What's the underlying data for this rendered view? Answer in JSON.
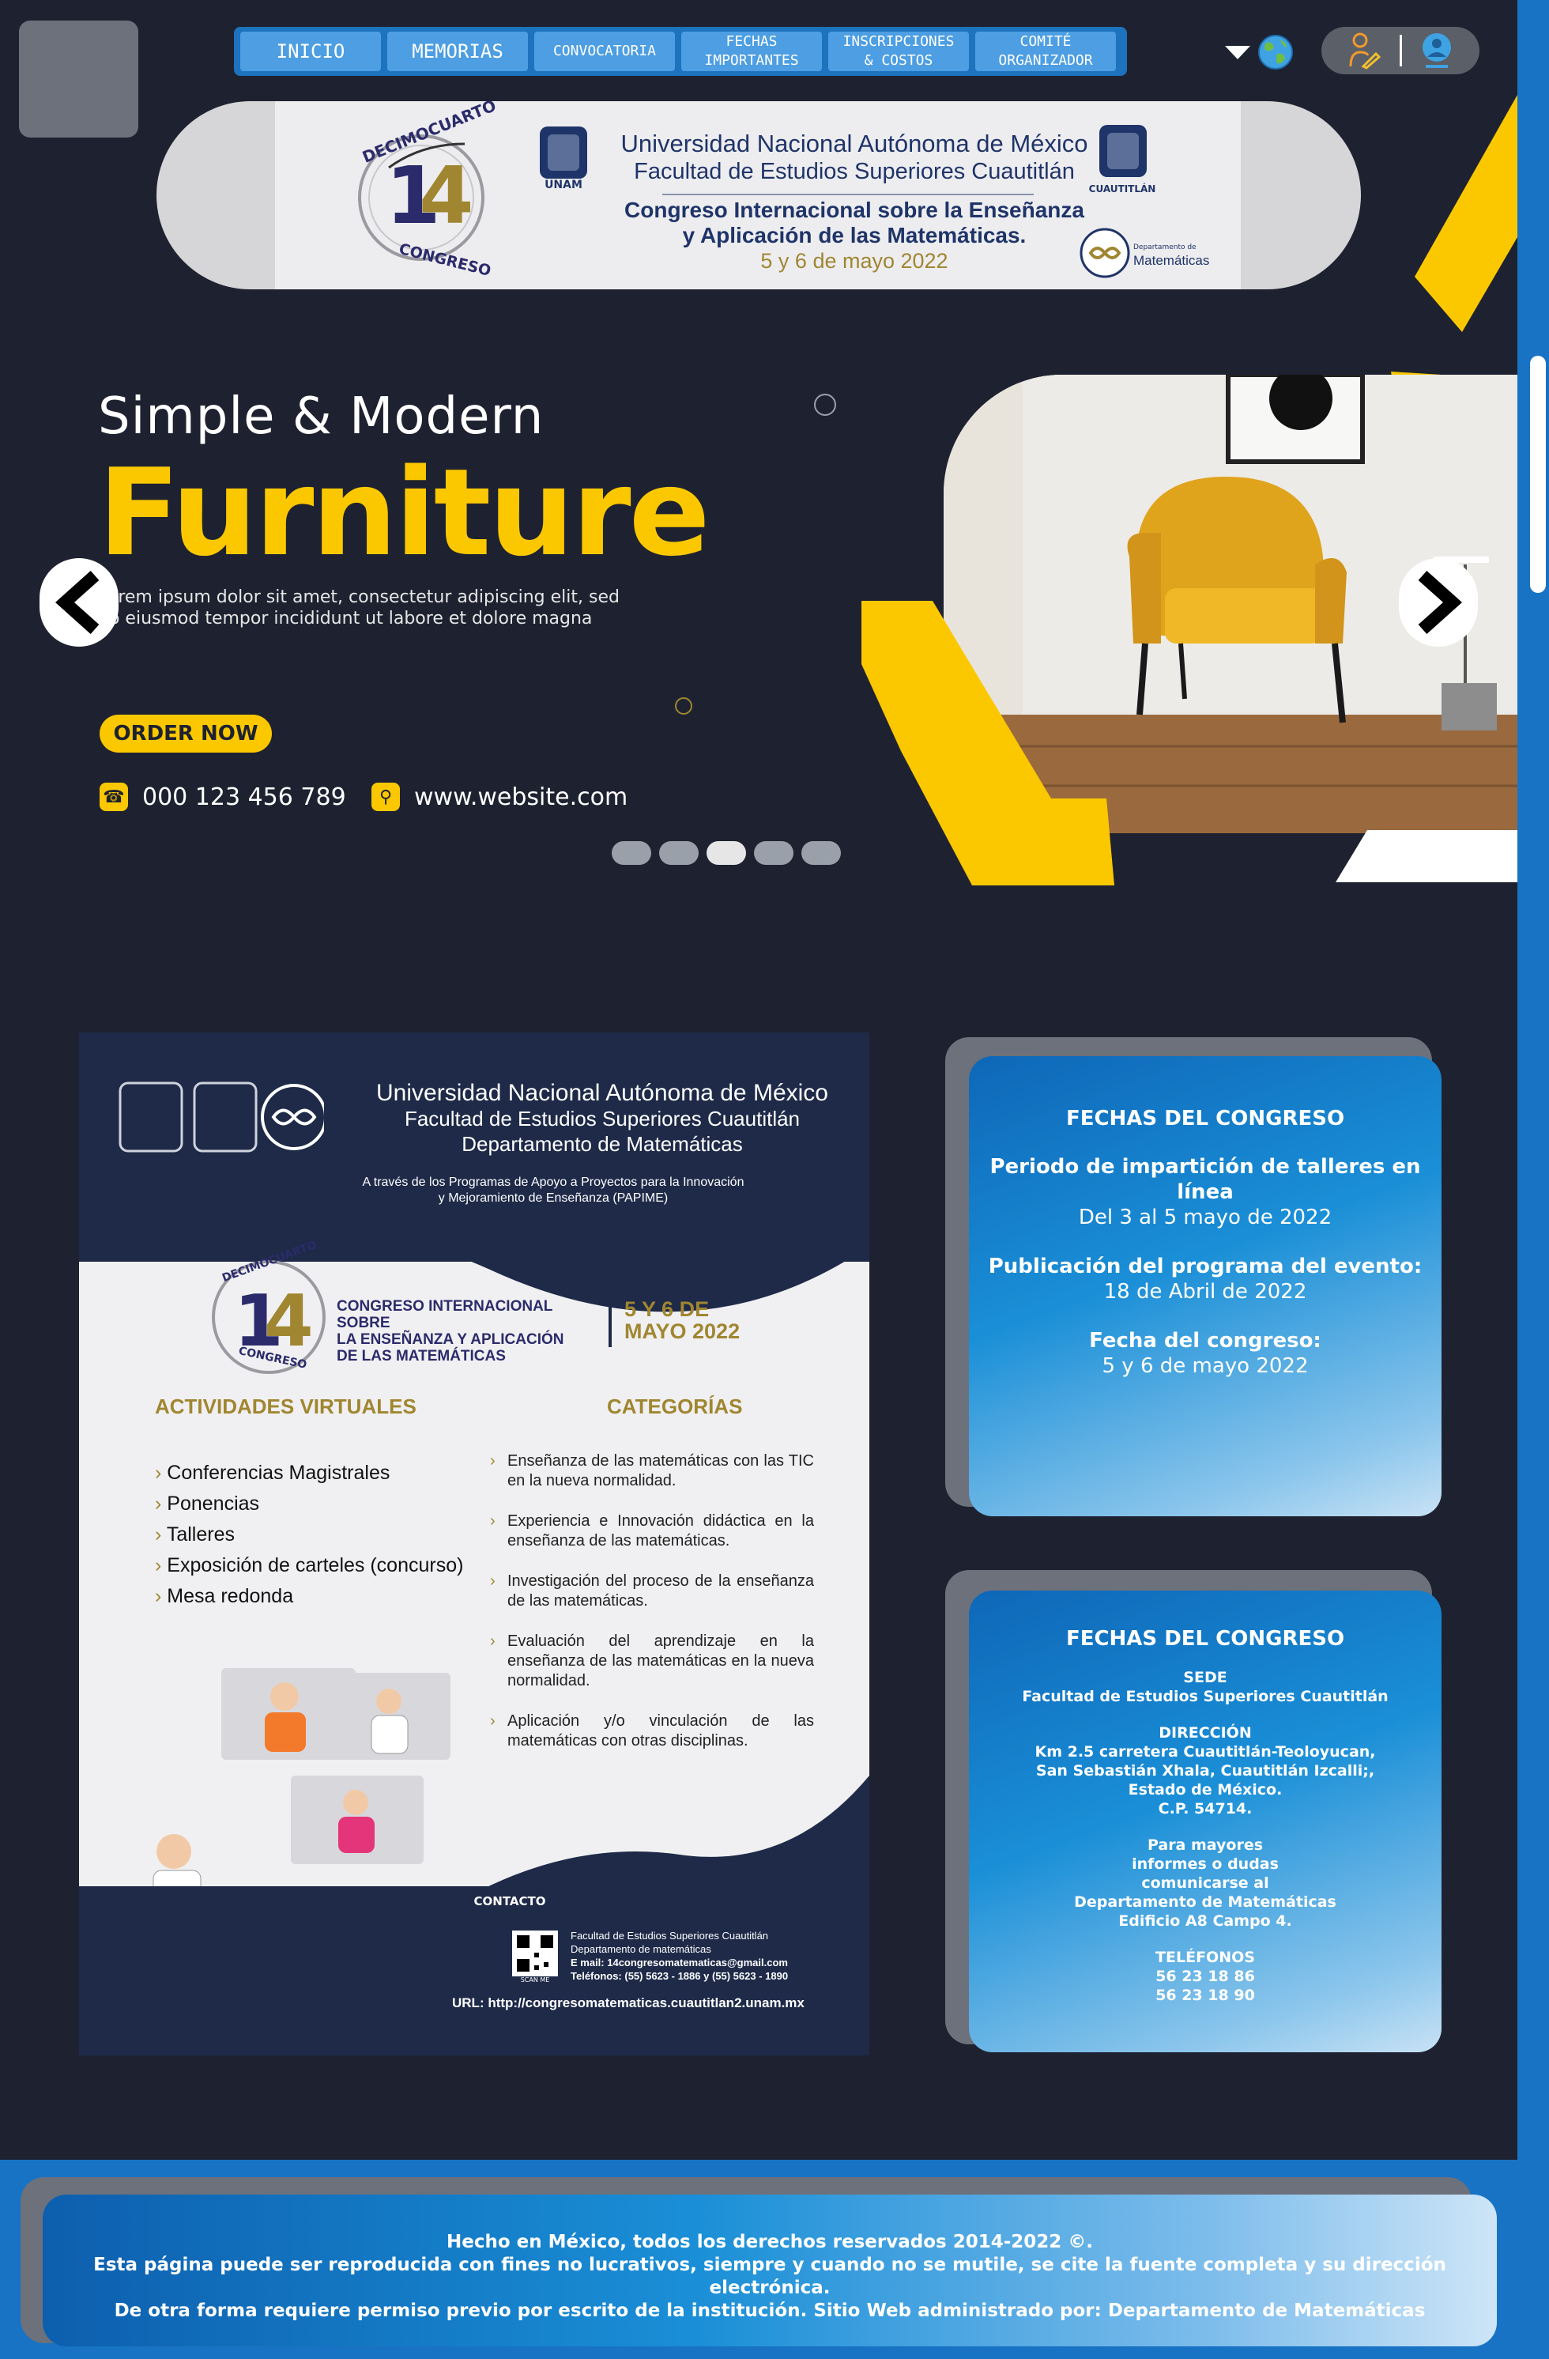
{
  "nav": {
    "items": [
      {
        "label": "INICIO",
        "size": "big"
      },
      {
        "label": "MEMORIAS",
        "size": "big"
      },
      {
        "label": "CONVOCATORIA",
        "size": "small"
      },
      {
        "label": "FECHAS\nIMPORTANTES",
        "size": "small"
      },
      {
        "label": "INSCRIPCIONES\n& COSTOS",
        "size": "small"
      },
      {
        "label": "COMITÉ\nORGANIZADOR",
        "size": "small"
      }
    ]
  },
  "banner": {
    "logo_top": "DECIMOCUARTO",
    "logo_number": "14",
    "logo_bottom": "CONGRESO",
    "university": "Universidad Nacional Autónoma de México",
    "faculty": "Facultad de Estudios Superiores Cuautitlán",
    "unam_label": "UNAM",
    "cuautitlan_label": "CUAUTITLÁN",
    "congress_line1": "Congreso Internacional sobre la Enseñanza",
    "congress_line2": "y Aplicación de las Matemáticas.",
    "dates": "5 y 6 de mayo 2022",
    "dept_small": "Departamento de",
    "dept_big": "Matemáticas"
  },
  "hero": {
    "subtitle": "Simple & Modern",
    "title": "Furniture",
    "description": "Lorem ipsum dolor sit amet, consectetur adipiscing elit, sed do eiusmod tempor incididunt ut labore et dolore magna",
    "order_button": "ORDER NOW",
    "phone": "000 123 456 789",
    "website": "www.website.com",
    "slides_count": 5,
    "active_slide": 2
  },
  "poster": {
    "university": "Universidad Nacional Autónoma de México",
    "faculty": "Facultad de Estudios Superiores Cuautitlán",
    "department": "Departamento de Matemáticas",
    "program_line1": "A través de los Programas de Apoyo a Proyectos para la Innovación",
    "program_line2": "y Mejoramiento de Enseñanza (PAPIME)",
    "logo_top": "DECIMOCUARTO",
    "logo_number": "14",
    "logo_bottom": "CONGRESO",
    "congress_line1": "CONGRESO INTERNACIONAL SOBRE",
    "congress_line2": "LA ENSEÑANZA Y APLICACIÓN",
    "congress_line3": "DE LAS MATEMÁTICAS",
    "date_line1": "5 Y 6 DE",
    "date_line2": "MAYO 2022",
    "activities_title": "ACTIVIDADES VIRTUALES",
    "activities": [
      "Conferencias Magistrales",
      "Ponencias",
      "Talleres",
      "Exposición de carteles (concurso)",
      "Mesa redonda"
    ],
    "categories_title": "CATEGORÍAS",
    "categories": [
      "Enseñanza de las matemáticas con las TIC en la nueva normalidad.",
      "Experiencia e Innovación didáctica en la enseñanza de las matemáticas.",
      "Investigación del proceso de la enseñanza de las matemáticas.",
      "Evaluación del aprendizaje en la enseñanza de las matemáticas en la nueva normalidad.",
      "Aplicación y/o vinculación de las matemáticas con otras disciplinas."
    ],
    "contact_title": "CONTACTO",
    "contact_line1": "Facultad de Estudios Superiores Cuautitlán",
    "contact_line2": "Departamento de matemáticas",
    "contact_email": "E mail: 14congresomatematicas@gmail.com",
    "contact_phones": "Teléfonos: (55) 5623 - 1886 y (55) 5623 - 1890",
    "scan_label": "SCAN ME",
    "url_label": "URL:",
    "url": "http://congresomatematicas.cuautitlan2.unam.mx"
  },
  "card1": {
    "title": "FECHAS DEL CONGRESO",
    "items": [
      {
        "label": "Periodo de impartición de talleres en línea",
        "value": "Del 3 al 5 mayo de 2022"
      },
      {
        "label": "Publicación del programa del evento:",
        "value": "18 de Abril de 2022"
      },
      {
        "label": "Fecha del congreso:",
        "value": "5 y 6 de mayo 2022"
      }
    ]
  },
  "card2": {
    "title": "FECHAS DEL CONGRESO",
    "sede_label": "SEDE",
    "sede_value": "Facultad de Estudios Superiores Cuautitlán",
    "direccion_label": "DIRECCIÓN",
    "direccion_value": "Km 2.5 carretera Cuautitlán-Teoloyucan,\nSan Sebastián Xhala, Cuautitlán Izcalli;,\nEstado de México.\nC.P. 54714.",
    "info": "Para mayores\ninformes o dudas\ncomunicarse al\nDepartamento de Matemáticas\nEdificio A8 Campo 4.",
    "telefonos_label": "TELÉFONOS",
    "telefonos_value": "56 23 18 86\n56 23 18 90"
  },
  "footer": {
    "line1": "Hecho en México, todos los derechos reservados 2014-2022 ©.",
    "line2": "Esta página puede ser reproducida con fines no lucrativos, siempre y cuando no se mutile, se cite la fuente completa y su dirección electrónica.",
    "line3": "De otra forma requiere permiso previo por escrito de la institución. Sitio Web administrado por: Departamento de Matemáticas"
  },
  "colors": {
    "background": "#1e2230",
    "accent_yellow": "#fbc800",
    "nav_blue": "#1d73be",
    "nav_item": "#4d9ee2",
    "poster_navy": "#1e2a48",
    "gold": "#a08630"
  },
  "icons": {
    "language": "globe-icon",
    "user_edit": "user-edit-icon",
    "account": "account-icon",
    "phone": "phone-icon",
    "link": "link-icon",
    "prev": "chevron-left-icon",
    "next": "chevron-right-icon"
  }
}
